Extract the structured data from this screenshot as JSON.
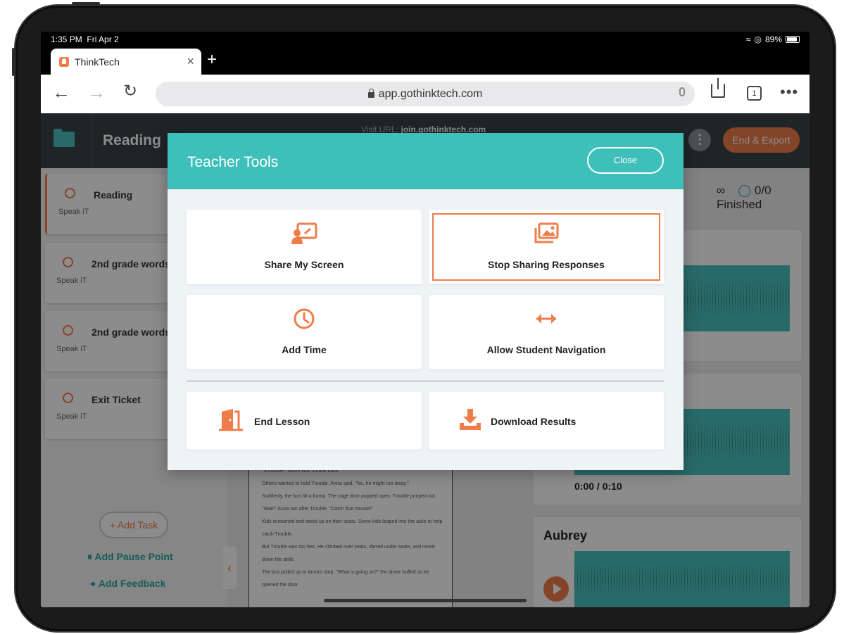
{
  "status_bar": {
    "time": "1:35 PM",
    "date": "Fri Apr 2",
    "battery": "89%"
  },
  "browser": {
    "tab_title": "ThinkTech",
    "url": "app.gothinktech.com",
    "tab_count": "1"
  },
  "app": {
    "lesson_title": "Reading",
    "visit_url_label": "Visit URL:",
    "visit_url": "join.gothinktech.com",
    "end_export": "End & Export",
    "finished": "0/0 Finished",
    "infinity": "∞"
  },
  "sidebar": {
    "tasks": [
      {
        "name": "Reading",
        "type": "Speak iT"
      },
      {
        "name": "2nd grade words",
        "type": "Speak iT"
      },
      {
        "name": "2nd grade words",
        "type": "Speak iT"
      },
      {
        "name": "Exit Ticket",
        "type": "Speak iT"
      }
    ],
    "add_task": "+ Add Task",
    "add_pause_point": "Add Pause Point",
    "add_feedback": "Add Feedback"
  },
  "document": {
    "lines": [
      "\"A mouse!\" Some kids shrank back.",
      "Others wanted to hold Trouble. Anna said, \"No, he might run away.\"",
      "Suddenly, the bus hit a bump. The cage door popped open. Trouble jumped out.",
      "\"Wait!\" Anna ran after Trouble. \"Catch that mouse!\"",
      "Kids screamed and stood up on their seats. Some kids leaped into the aisle to help catch Trouble.",
      "But Trouble was too fast. He climbed over seats, darted under seats, and raced down the aisle.",
      "The bus pulled up to Anna's stop. \"What is going on?\" the driver huffed as he opened the door."
    ]
  },
  "responses": [
    {
      "time": "0:00 / 0:10"
    },
    {
      "name": "Aubrey"
    }
  ],
  "modal": {
    "title": "Teacher Tools",
    "close": "Close",
    "tools": {
      "share_screen": "Share My Screen",
      "stop_sharing": "Stop Sharing Responses",
      "add_time": "Add Time",
      "allow_navigation": "Allow Student Navigation",
      "end_lesson": "End Lesson",
      "download_results": "Download Results"
    }
  },
  "colors": {
    "accent": "#f07c4a",
    "teal": "#3fbfb9",
    "header_dark": "#3a4346"
  }
}
